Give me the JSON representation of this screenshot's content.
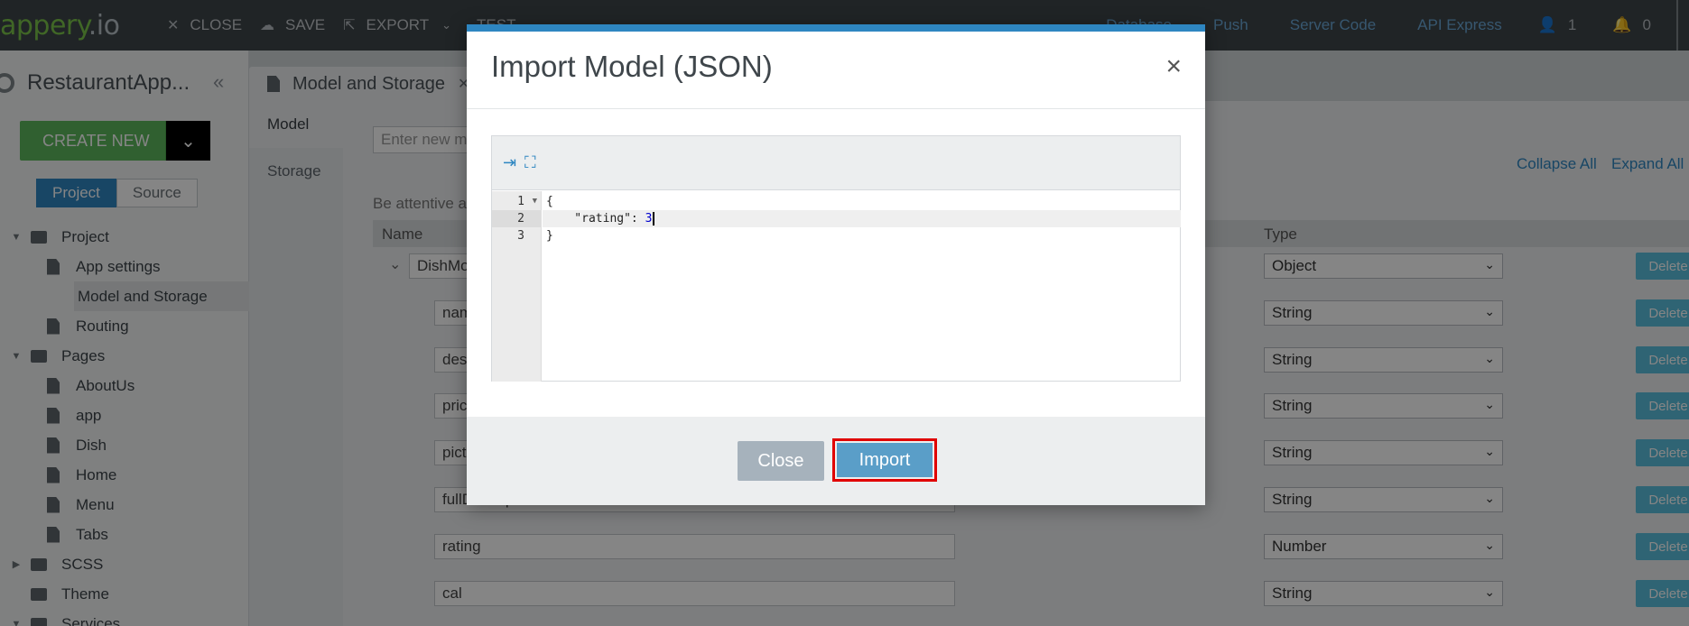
{
  "topbar": {
    "logo_main": "appery",
    "logo_suffix": ".io",
    "close": "CLOSE",
    "save": "SAVE",
    "export": "EXPORT",
    "test": "TEST",
    "links": [
      "Database",
      "Push",
      "Server Code",
      "API Express"
    ],
    "user_count": "1",
    "notif_count": "0"
  },
  "sidebar": {
    "project_name": "RestaurantApp...",
    "create_new": "CREATE NEW",
    "seg_project": "Project",
    "seg_source": "Source",
    "tree": [
      {
        "label": "Project",
        "kind": "folder",
        "level": 0
      },
      {
        "label": "App settings",
        "kind": "doc",
        "level": 1
      },
      {
        "label": "Model and Storage",
        "kind": "doc",
        "level": 1,
        "selected": true
      },
      {
        "label": "Routing",
        "kind": "doc",
        "level": 1
      },
      {
        "label": "Pages",
        "kind": "folder",
        "level": 0
      },
      {
        "label": "AboutUs",
        "kind": "doc",
        "level": 1
      },
      {
        "label": "app",
        "kind": "doc",
        "level": 1
      },
      {
        "label": "Dish",
        "kind": "doc",
        "level": 1
      },
      {
        "label": "Home",
        "kind": "doc",
        "level": 1
      },
      {
        "label": "Menu",
        "kind": "doc",
        "level": 1
      },
      {
        "label": "Tabs",
        "kind": "doc",
        "level": 1
      },
      {
        "label": "SCSS",
        "kind": "folder",
        "level": 0
      },
      {
        "label": "Theme",
        "kind": "folder",
        "level": 0
      },
      {
        "label": "Services",
        "kind": "folder",
        "level": 0
      }
    ]
  },
  "editor": {
    "tab_label": "Model and Storage",
    "subnav": [
      "Model",
      "Storage"
    ],
    "new_model_placeholder": "Enter new m",
    "attentive_text": "Be attentive a",
    "collapse_all": "Collapse All",
    "expand_all": "Expand All",
    "col_name": "Name",
    "col_type": "Type",
    "delete_label": "Delete",
    "rows": [
      {
        "name": "DishMo",
        "type": "Object"
      },
      {
        "name": "nam",
        "type": "String"
      },
      {
        "name": "desc",
        "type": "String"
      },
      {
        "name": "pric",
        "type": "String"
      },
      {
        "name": "pictu",
        "type": "String"
      },
      {
        "name": "fullDescription",
        "type": "String"
      },
      {
        "name": "rating",
        "type": "Number"
      },
      {
        "name": "cal",
        "type": "String"
      }
    ]
  },
  "modal": {
    "title": "Import Model (JSON)",
    "close_icon": "×",
    "line_numbers": [
      "1",
      "2",
      "3"
    ],
    "code_line_1": "{",
    "code_line_2_key": "    \"rating\": ",
    "code_line_2_value": "3",
    "code_line_3": "}",
    "btn_close": "Close",
    "btn_import": "Import"
  }
}
